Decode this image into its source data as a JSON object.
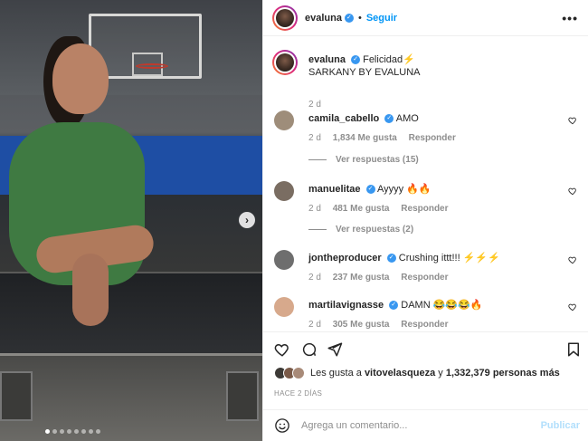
{
  "header": {
    "username": "evaluna",
    "separator": "•",
    "follow_label": "Seguir",
    "more_label": "•••"
  },
  "caption": {
    "username": "evaluna",
    "text": "Felicidad⚡",
    "line2": "SARKANY BY EVALUNA",
    "time": "2 d"
  },
  "comments": [
    {
      "username": "camila_cabello",
      "text": "AMO",
      "time": "2 d",
      "likes": "1,834 Me gusta",
      "reply": "Responder",
      "replies": "Ver respuestas (15)",
      "avatar_color": "#9e8d7a"
    },
    {
      "username": "manuelitae",
      "text": "Ayyyy 🔥🔥",
      "time": "2 d",
      "likes": "481 Me gusta",
      "reply": "Responder",
      "replies": "Ver respuestas (2)",
      "avatar_color": "#7a6d62"
    },
    {
      "username": "jontheproducer",
      "text": "Crushing ittt!!! ⚡⚡⚡",
      "time": "2 d",
      "likes": "237 Me gusta",
      "reply": "Responder",
      "avatar_color": "#6e6e6e"
    },
    {
      "username": "martilavignasse",
      "text": "DAMN 😂😂😂🔥",
      "time": "2 d",
      "likes": "305 Me gusta",
      "reply": "Responder",
      "avatar_color": "#d7a98c"
    }
  ],
  "likes": {
    "prefix": "Les gusta a",
    "user": "vitovelasquezа",
    "middle": "y",
    "count": "1,332,379 personas más"
  },
  "time_ago": "HACE 2 DÍAS",
  "comment_box": {
    "placeholder": "Agrega un comentario...",
    "publish_label": "Publicar"
  },
  "photo": {
    "slides": 8,
    "active_slide": 1
  }
}
